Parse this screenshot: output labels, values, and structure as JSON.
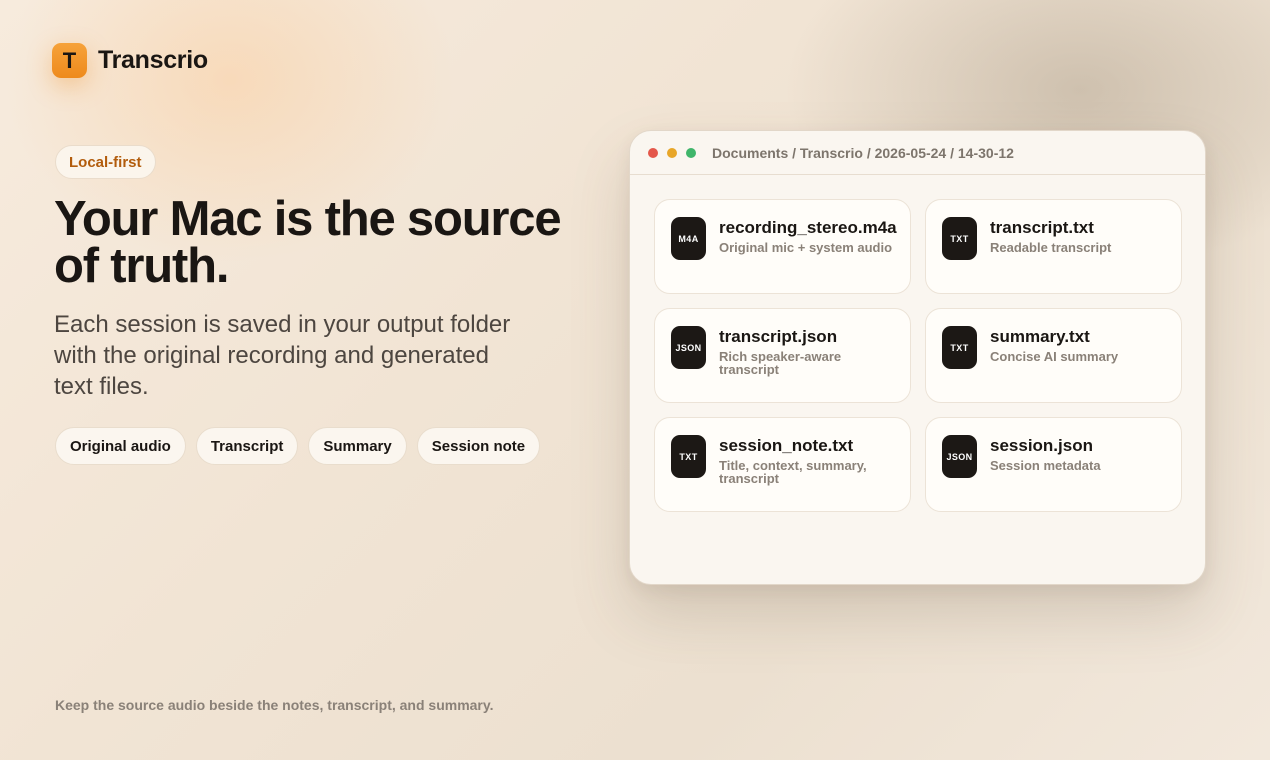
{
  "brand": {
    "mark": "T",
    "name": "Transcrio"
  },
  "hero": {
    "tag": "Local-first",
    "headline": "Your Mac is the source of truth.",
    "subtext": "Each session is saved in your output folder with the original recording and generated text files.",
    "chips": [
      "Original audio",
      "Transcript",
      "Summary",
      "Session note"
    ]
  },
  "footer_note": "Keep the source audio beside the notes, transcript, and summary.",
  "window": {
    "path": "Documents / Transcrio / 2026-05-24 / 14-30-12",
    "files": [
      {
        "badge": "M4A",
        "name": "recording_stereo.m4a",
        "desc": "Original mic + system audio"
      },
      {
        "badge": "TXT",
        "name": "transcript.txt",
        "desc": "Readable transcript"
      },
      {
        "badge": "JSON",
        "name": "transcript.json",
        "desc": "Rich speaker-aware transcript"
      },
      {
        "badge": "TXT",
        "name": "summary.txt",
        "desc": "Concise AI summary"
      },
      {
        "badge": "TXT",
        "name": "session_note.txt",
        "desc": "Title, context, summary, transcript"
      },
      {
        "badge": "JSON",
        "name": "session.json",
        "desc": "Session metadata"
      }
    ]
  },
  "colors": {
    "accent": "#ee8a1c",
    "tag_text": "#b25c0c",
    "traffic_red": "#e4574a",
    "traffic_yellow": "#e8a628",
    "traffic_green": "#3fb56a"
  }
}
